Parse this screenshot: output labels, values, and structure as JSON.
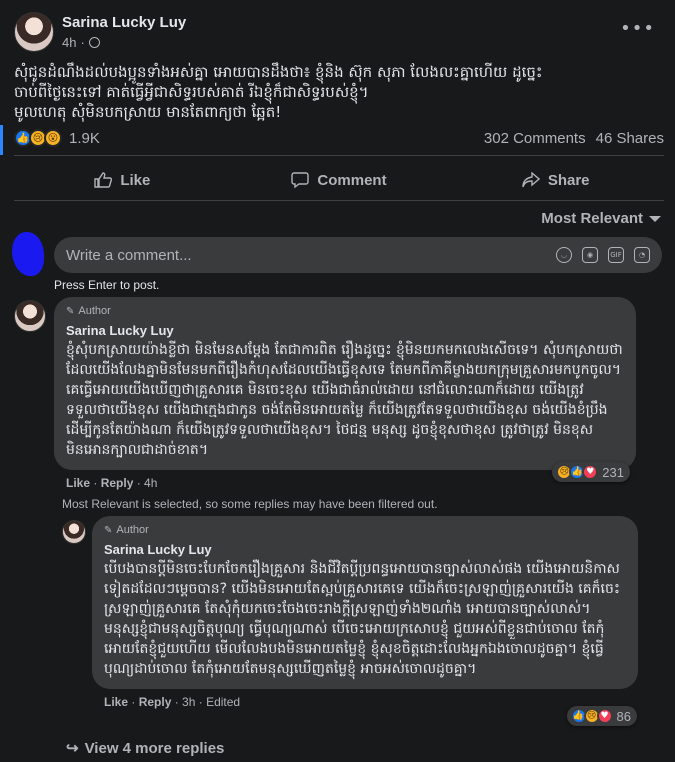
{
  "post": {
    "author": "Sarina Lucky Luy",
    "time": "4h",
    "more": "•••",
    "text_line1": "សុំជូនដំណឹងដល់បងប្អូនទាំងអស់គ្នា អោយបានដឹងថា៖ ខ្ញុំនិង ស៊ុក សុភា លែងលះគ្នាហើយ ដូច្នេះ",
    "text_line2": "ចាប់ពីថ្ងៃនេះទៅ គាត់ធ្វើអ្វីជាសិទ្ធរបស់គាត់ រីឯខ្ញុំក៏ជាសិទ្ធរបស់ខ្ញុំ។",
    "text_line3": "មូលហេតុ សុំមិនបកស្រាយ មានតែពាក្យថា ឆ្អែត!",
    "reaction_count": "1.9K",
    "comments_count": "302 Comments",
    "shares_count": "46 Shares"
  },
  "actions": {
    "like": "Like",
    "comment": "Comment",
    "share": "Share"
  },
  "sort": {
    "label": "Most Relevant"
  },
  "composer": {
    "placeholder": "Write a comment...",
    "hint": "Press Enter to post."
  },
  "comment1": {
    "badge": "Author",
    "author": "Sarina Lucky Luy",
    "text": "ខ្ញុំសុំបកស្រាយយ៉ាងខ្លីថា មិនមែនសម្ដែង តែជាការពិត រឿងដូច្នេះ ខ្ញុំមិនយកមកលេងសើចទេ។ សុំបកស្រាយថា ដែលយើងលែងគ្នាមិនមែនមកពីរឿងកំហុសដែលយើងធ្វើខុសទេ តែមកពីភាគីម្ខាងយកក្រុមគ្រួសារមកបូកចូល។ គេធ្វើអោយយើងឃើញថាគ្រួសារគេ មិនចេះខុស យើងជាធំរាល់ដោយ នៅជំលោះណាក៏ដោយ យើងត្រូវទទួលថាយើងខុស យើងជាក្មេងជាកូន ចង់តែមិនអោយតម្លៃ ក៏យើងត្រូវតែទទួលថាយើងខុស ចង់យើងខំប្រឹងដើម្បីកូនតែយ៉ាងណា ក៏យើងត្រូវទទួលថាយើងខុស។ ថៃជន្ម មនុស្ស ដូចខ្ញុំខុសថាខុស ត្រូវថាត្រូវ មិនខុសមិនអោនក្បាលជាដាច់ខាត។",
    "like": "Like",
    "reply": "Reply",
    "time": "4h",
    "reaction_count": "231"
  },
  "filter_note": "Most Relevant is selected, so some replies may have been filtered out.",
  "comment2": {
    "badge": "Author",
    "author": "Sarina Lucky Luy",
    "text": "បើបងបានប្តីមិនចេះបែកចែករឿងគ្រួសារ និងជីវិតប្ដីប្រពន្ធអោយបានច្បាស់លាស់ផង យើងអោយនិកាសទៀតដដែលៗម្ដេចបាន? យើងមិនអោយតែស្អប់គ្រួសារគេទេ យើងក៏ចេះស្រឡាញ់គ្រួសារយើង គេក៏ចេះស្រឡាញ់គ្រួសារគេ តែសុំកុំយកចេះចែងចេះរាងក្តីស្រឡាញ់ទាំង២ណាំង អោយបានច្បាស់លាស់។ មនុស្សខ្ញុំជាមនុស្សចិត្តបុណ្យ ធ្វើបុណ្យណាស់ បើចេះអោយក្រសោបខ្ញុំ ជួយអស់ពីខ្លួនជាប់ចោល តែកុំអោយតែខ្ញុំជួយហើយ មើលលែងបងមិនអោយតម្លៃខ្ញុំ ខ្ញុំសុខចិត្តដោះលែងអ្នកឯងចោលដូចគ្នា។ ខ្ញុំធ្វើបុណ្យដាប់ចោល តែកុំអោយតែមនុស្សឃើញតម្លៃខ្ញុំ អាចអស់ចោលដូចគ្នា។",
    "like": "Like",
    "reply": "Reply",
    "time": "3h",
    "edited": "Edited",
    "reaction_count": "86"
  },
  "view_more": "View 4 more replies",
  "colors": {
    "background": "#18191a",
    "bubble": "#3a3b3c",
    "text": "#e4e6eb",
    "secondary": "#b0b3b8",
    "like_blue": "#1877f2"
  }
}
